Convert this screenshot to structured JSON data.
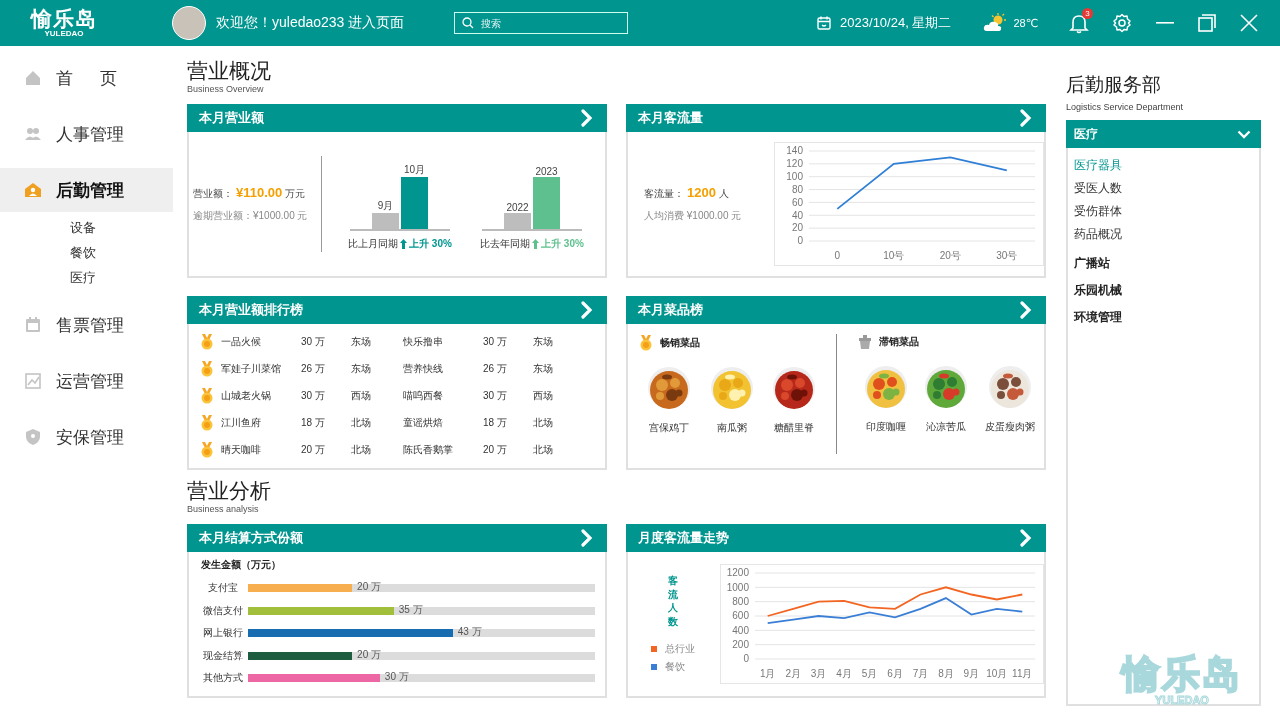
{
  "top_bar": {
    "logo": {
      "name": "愉乐岛",
      "sub": "YULEDAO"
    },
    "welcome": "欢迎您！yuledao233 进入页面",
    "search": {
      "placeholder": "搜索"
    },
    "date": "2023/10/24, 星期二",
    "temperature": "28℃",
    "notification_count": "3"
  },
  "sidebar": {
    "items": [
      {
        "label": "首 页",
        "selected": false
      },
      {
        "label": "人事管理",
        "selected": false
      },
      {
        "label": "后勤管理",
        "selected": true,
        "expanded": true,
        "children": [
          {
            "label": "设备",
            "selected": false
          },
          {
            "label": "餐饮",
            "selected": false
          },
          {
            "label": "医疗",
            "selected": false
          }
        ]
      },
      {
        "label": "售票管理",
        "selected": false
      },
      {
        "label": "运营管理",
        "selected": false
      },
      {
        "label": "安保管理",
        "selected": false
      }
    ]
  },
  "overview": {
    "title": "营业概况",
    "subtitle": "Business Overview",
    "revenue_card": {
      "title": "本月营业额",
      "label": "营业额：",
      "value": "¥110.00",
      "unit": "万元",
      "note": "逾期营业额：¥1000.00 元",
      "comparisons": [
        {
          "bars": [
            "9月",
            "10月"
          ],
          "caption": "比上月同期",
          "trend": "上升 30%",
          "color": "#00958f"
        },
        {
          "bars": [
            "2022",
            "2023"
          ],
          "caption": "比去年同期",
          "trend": "上升 30%",
          "color": "#5ec08e"
        }
      ]
    },
    "traffic_card": {
      "title": "本月客流量",
      "label": "客流量：",
      "value": "1200",
      "unit": "人",
      "note": "人均消费 ¥1000.00 元",
      "chart_data": {
        "type": "line",
        "categories": [
          "0",
          "10号",
          "20号",
          "30号"
        ],
        "series": [
          {
            "color": "#2f7fd6",
            "values": [
              50,
              120,
              130,
              110
            ]
          }
        ],
        "grid": true,
        "ylim": [
          0,
          140
        ],
        "yticks": [
          0,
          20,
          40,
          60,
          80,
          100,
          120,
          140
        ]
      }
    },
    "ranking_card": {
      "title": "本月营业额排行榜",
      "rows": [
        {
          "name": "一品火候",
          "amount": "30 万",
          "area": "东场"
        },
        {
          "name": "军娃子川菜馆",
          "amount": "26 万",
          "area": "东场"
        },
        {
          "name": "山城老火锅",
          "amount": "30 万",
          "area": "西场"
        },
        {
          "name": "江川鱼府",
          "amount": "18 万",
          "area": "北场"
        },
        {
          "name": "晴天咖啡",
          "amount": "20 万",
          "area": "北场"
        },
        {
          "name": "快乐撸串",
          "amount": "30 万",
          "area": "东场"
        },
        {
          "name": "营养快线",
          "amount": "26 万",
          "area": "东场"
        },
        {
          "name": "喵呜西餐",
          "amount": "30 万",
          "area": "西场"
        },
        {
          "name": "童谣烘焙",
          "amount": "18 万",
          "area": "北场"
        },
        {
          "name": "陈氏香鹅掌",
          "amount": "20 万",
          "area": "北场"
        }
      ]
    },
    "dish_card": {
      "title": "本月菜品榜",
      "groups": [
        {
          "kind": "best",
          "title": "畅销菜品",
          "dishes": [
            "宫保鸡丁",
            "南瓜粥",
            "糖醋里脊"
          ]
        },
        {
          "kind": "slow",
          "title": "滞销菜品",
          "dishes": [
            "印度咖喱",
            "沁凉苦瓜",
            "皮蛋瘦肉粥"
          ]
        }
      ]
    }
  },
  "analysis": {
    "title": "营业分析",
    "subtitle": "Business analysis",
    "payment_card": {
      "title": "本月结算方式份额",
      "heading": "发生金额（万元）",
      "rows": [
        {
          "label": "支付宝",
          "value": "20 万",
          "level": 0.3,
          "color": "#f7ae4f"
        },
        {
          "label": "微信支付",
          "value": "35 万",
          "level": 0.42,
          "color": "#a2bf3c"
        },
        {
          "label": "网上银行",
          "value": "43 万",
          "level": 0.59,
          "color": "#176db0"
        },
        {
          "label": "现金结算",
          "value": "20 万",
          "level": 0.3,
          "color": "#1e5c3f"
        },
        {
          "label": "其他方式",
          "value": "30 万",
          "level": 0.38,
          "color": "#ec67a3"
        }
      ]
    },
    "trend_card": {
      "title": "月度客流量走势",
      "axis_label": "客流人数",
      "chart_data": {
        "type": "line",
        "categories": [
          "1月",
          "2月",
          "3月",
          "4月",
          "5月",
          "6月",
          "7月",
          "8月",
          "9月",
          "10月",
          "11月"
        ],
        "grid": true,
        "ylim": [
          0,
          1200
        ],
        "yticks": [
          0,
          200,
          400,
          600,
          800,
          1000,
          1200
        ],
        "series": [
          {
            "name": "总行业",
            "color": "#f26522",
            "values": [
              600,
              700,
              800,
              810,
              720,
              700,
              900,
              1000,
              900,
              830,
              900
            ]
          },
          {
            "name": "餐饮",
            "color": "#3a7fd5",
            "values": [
              500,
              550,
              600,
              570,
              650,
              580,
              700,
              850,
              620,
              700,
              660
            ]
          }
        ]
      }
    }
  },
  "right_panel": {
    "title": "后勤服务部",
    "subtitle": "Logistics Service Department",
    "groups": [
      {
        "label": "医疗",
        "expanded": true,
        "children": [
          {
            "label": "医疗器具",
            "selected": true
          },
          {
            "label": "受医人数",
            "selected": false
          },
          {
            "label": "受伤群体",
            "selected": false
          },
          {
            "label": "药品概况",
            "selected": false
          }
        ]
      },
      {
        "label": "广播站",
        "expanded": false
      },
      {
        "label": "乐园机械",
        "expanded": false
      },
      {
        "label": "环境管理",
        "expanded": false
      }
    ]
  },
  "corner_logo": {
    "name": "愉乐岛",
    "sub": "YULEDAO"
  }
}
